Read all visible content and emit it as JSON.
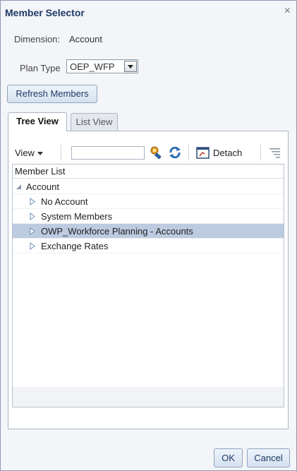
{
  "dialog": {
    "title": "Member Selector",
    "close_glyph": "×"
  },
  "dimension": {
    "label": "Dimension:",
    "value": "Account"
  },
  "plan_type": {
    "label": "Plan Type",
    "selected": "OEP_WFP"
  },
  "buttons": {
    "refresh": "Refresh Members",
    "ok": "OK",
    "cancel": "Cancel"
  },
  "tabs": [
    {
      "label": "Tree View",
      "active": true
    },
    {
      "label": "List View",
      "active": false
    }
  ],
  "toolbar": {
    "view_label": "View",
    "search_placeholder": "",
    "detach_label": "Detach"
  },
  "member_list": {
    "header": "Member List",
    "items": [
      {
        "label": "Account",
        "expanded": true,
        "selected": false
      },
      {
        "label": "No Account",
        "expanded": false,
        "selected": false
      },
      {
        "label": "System Members",
        "expanded": false,
        "selected": false
      },
      {
        "label": "OWP_Workforce Planning - Accounts",
        "expanded": false,
        "selected": true
      },
      {
        "label": "Exchange Rates",
        "expanded": false,
        "selected": false
      }
    ]
  },
  "colors": {
    "title": "#1f3a66",
    "selected_row": "#bccbe0",
    "button_border": "#8fa3bf"
  }
}
